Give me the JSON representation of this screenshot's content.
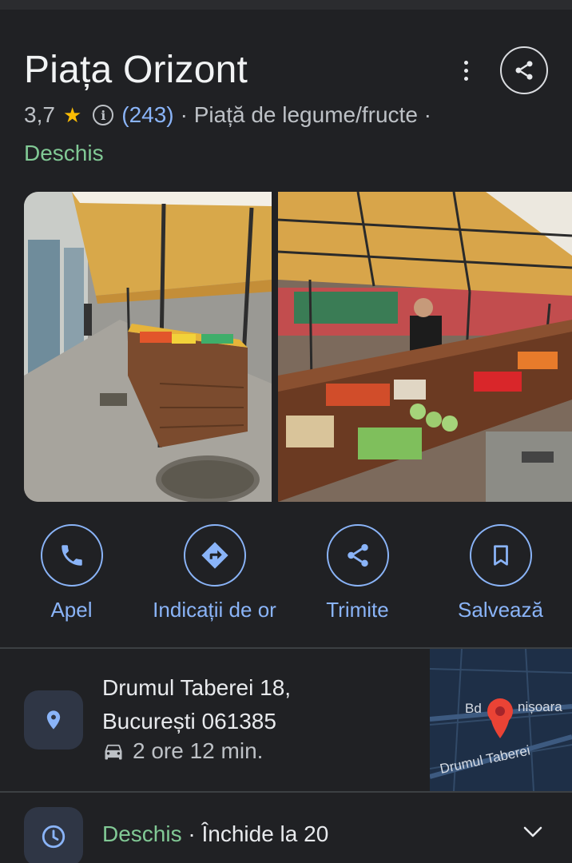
{
  "place": {
    "title": "Piața Orizont",
    "rating": "3,7",
    "reviews": "(243)",
    "category": "· Piață de legume/fructe ·",
    "status": "Deschis"
  },
  "actions": [
    {
      "label": "Apel",
      "icon": "phone-icon"
    },
    {
      "label": "Indicații de or",
      "icon": "directions-icon"
    },
    {
      "label": "Trimite",
      "icon": "share-icon"
    },
    {
      "label": "Salvează",
      "icon": "bookmark-icon"
    }
  ],
  "address": {
    "line1": "Drumul Taberei 18,",
    "line2": "București 061385",
    "travel_time": "2 ore 12 min.",
    "travel_icon": "car-icon"
  },
  "map": {
    "label_street1": "Bd",
    "label_street1_rest": "nișoara",
    "label_street2": "Drumul Taberei"
  },
  "hours": {
    "status": "Deschis",
    "closes": " · Închide la 20"
  },
  "colors": {
    "background": "#202124",
    "accent_blue": "#8ab4f8",
    "open_green": "#81c995",
    "star_yellow": "#fbbc04",
    "pin_red": "#ea4335"
  }
}
